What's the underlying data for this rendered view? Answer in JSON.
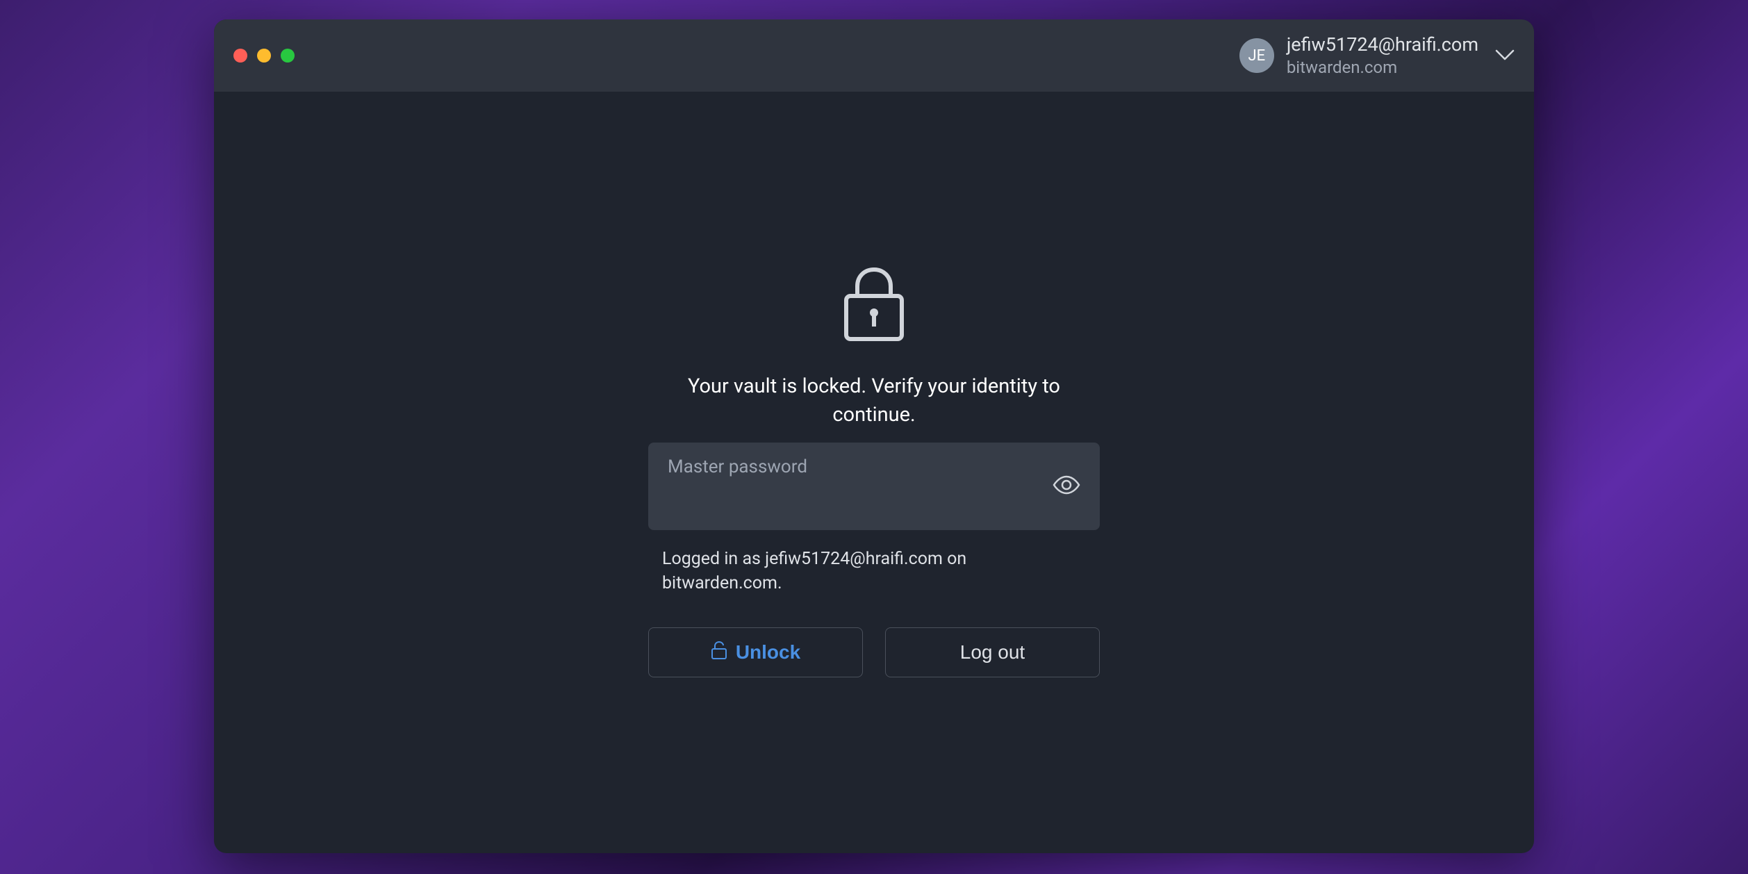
{
  "header": {
    "avatar_initials": "JE",
    "email": "jefiw51724@hraifi.com",
    "domain": "bitwarden.com"
  },
  "lock_screen": {
    "message": "Your vault is locked. Verify your identity to continue.",
    "password_label": "Master password",
    "logged_in_text": "Logged in as jefiw51724@hraifi.com on bitwarden.com.",
    "unlock_button": "Unlock",
    "logout_button": "Log out"
  },
  "colors": {
    "accent": "#4a90e2",
    "window_bg": "#1f242e",
    "titlebar_bg": "#2f343e",
    "input_bg": "#363c47"
  }
}
